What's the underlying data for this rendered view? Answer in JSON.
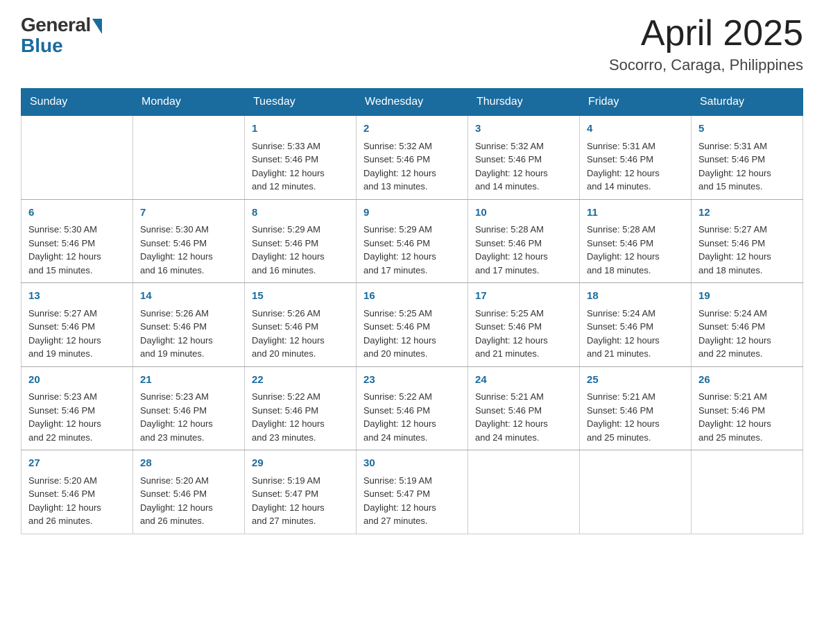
{
  "logo": {
    "general": "General",
    "blue": "Blue"
  },
  "title": "April 2025",
  "location": "Socorro, Caraga, Philippines",
  "weekdays": [
    "Sunday",
    "Monday",
    "Tuesday",
    "Wednesday",
    "Thursday",
    "Friday",
    "Saturday"
  ],
  "weeks": [
    [
      {
        "day": "",
        "info": ""
      },
      {
        "day": "",
        "info": ""
      },
      {
        "day": "1",
        "info": "Sunrise: 5:33 AM\nSunset: 5:46 PM\nDaylight: 12 hours\nand 12 minutes."
      },
      {
        "day": "2",
        "info": "Sunrise: 5:32 AM\nSunset: 5:46 PM\nDaylight: 12 hours\nand 13 minutes."
      },
      {
        "day": "3",
        "info": "Sunrise: 5:32 AM\nSunset: 5:46 PM\nDaylight: 12 hours\nand 14 minutes."
      },
      {
        "day": "4",
        "info": "Sunrise: 5:31 AM\nSunset: 5:46 PM\nDaylight: 12 hours\nand 14 minutes."
      },
      {
        "day": "5",
        "info": "Sunrise: 5:31 AM\nSunset: 5:46 PM\nDaylight: 12 hours\nand 15 minutes."
      }
    ],
    [
      {
        "day": "6",
        "info": "Sunrise: 5:30 AM\nSunset: 5:46 PM\nDaylight: 12 hours\nand 15 minutes."
      },
      {
        "day": "7",
        "info": "Sunrise: 5:30 AM\nSunset: 5:46 PM\nDaylight: 12 hours\nand 16 minutes."
      },
      {
        "day": "8",
        "info": "Sunrise: 5:29 AM\nSunset: 5:46 PM\nDaylight: 12 hours\nand 16 minutes."
      },
      {
        "day": "9",
        "info": "Sunrise: 5:29 AM\nSunset: 5:46 PM\nDaylight: 12 hours\nand 17 minutes."
      },
      {
        "day": "10",
        "info": "Sunrise: 5:28 AM\nSunset: 5:46 PM\nDaylight: 12 hours\nand 17 minutes."
      },
      {
        "day": "11",
        "info": "Sunrise: 5:28 AM\nSunset: 5:46 PM\nDaylight: 12 hours\nand 18 minutes."
      },
      {
        "day": "12",
        "info": "Sunrise: 5:27 AM\nSunset: 5:46 PM\nDaylight: 12 hours\nand 18 minutes."
      }
    ],
    [
      {
        "day": "13",
        "info": "Sunrise: 5:27 AM\nSunset: 5:46 PM\nDaylight: 12 hours\nand 19 minutes."
      },
      {
        "day": "14",
        "info": "Sunrise: 5:26 AM\nSunset: 5:46 PM\nDaylight: 12 hours\nand 19 minutes."
      },
      {
        "day": "15",
        "info": "Sunrise: 5:26 AM\nSunset: 5:46 PM\nDaylight: 12 hours\nand 20 minutes."
      },
      {
        "day": "16",
        "info": "Sunrise: 5:25 AM\nSunset: 5:46 PM\nDaylight: 12 hours\nand 20 minutes."
      },
      {
        "day": "17",
        "info": "Sunrise: 5:25 AM\nSunset: 5:46 PM\nDaylight: 12 hours\nand 21 minutes."
      },
      {
        "day": "18",
        "info": "Sunrise: 5:24 AM\nSunset: 5:46 PM\nDaylight: 12 hours\nand 21 minutes."
      },
      {
        "day": "19",
        "info": "Sunrise: 5:24 AM\nSunset: 5:46 PM\nDaylight: 12 hours\nand 22 minutes."
      }
    ],
    [
      {
        "day": "20",
        "info": "Sunrise: 5:23 AM\nSunset: 5:46 PM\nDaylight: 12 hours\nand 22 minutes."
      },
      {
        "day": "21",
        "info": "Sunrise: 5:23 AM\nSunset: 5:46 PM\nDaylight: 12 hours\nand 23 minutes."
      },
      {
        "day": "22",
        "info": "Sunrise: 5:22 AM\nSunset: 5:46 PM\nDaylight: 12 hours\nand 23 minutes."
      },
      {
        "day": "23",
        "info": "Sunrise: 5:22 AM\nSunset: 5:46 PM\nDaylight: 12 hours\nand 24 minutes."
      },
      {
        "day": "24",
        "info": "Sunrise: 5:21 AM\nSunset: 5:46 PM\nDaylight: 12 hours\nand 24 minutes."
      },
      {
        "day": "25",
        "info": "Sunrise: 5:21 AM\nSunset: 5:46 PM\nDaylight: 12 hours\nand 25 minutes."
      },
      {
        "day": "26",
        "info": "Sunrise: 5:21 AM\nSunset: 5:46 PM\nDaylight: 12 hours\nand 25 minutes."
      }
    ],
    [
      {
        "day": "27",
        "info": "Sunrise: 5:20 AM\nSunset: 5:46 PM\nDaylight: 12 hours\nand 26 minutes."
      },
      {
        "day": "28",
        "info": "Sunrise: 5:20 AM\nSunset: 5:46 PM\nDaylight: 12 hours\nand 26 minutes."
      },
      {
        "day": "29",
        "info": "Sunrise: 5:19 AM\nSunset: 5:47 PM\nDaylight: 12 hours\nand 27 minutes."
      },
      {
        "day": "30",
        "info": "Sunrise: 5:19 AM\nSunset: 5:47 PM\nDaylight: 12 hours\nand 27 minutes."
      },
      {
        "day": "",
        "info": ""
      },
      {
        "day": "",
        "info": ""
      },
      {
        "day": "",
        "info": ""
      }
    ]
  ]
}
